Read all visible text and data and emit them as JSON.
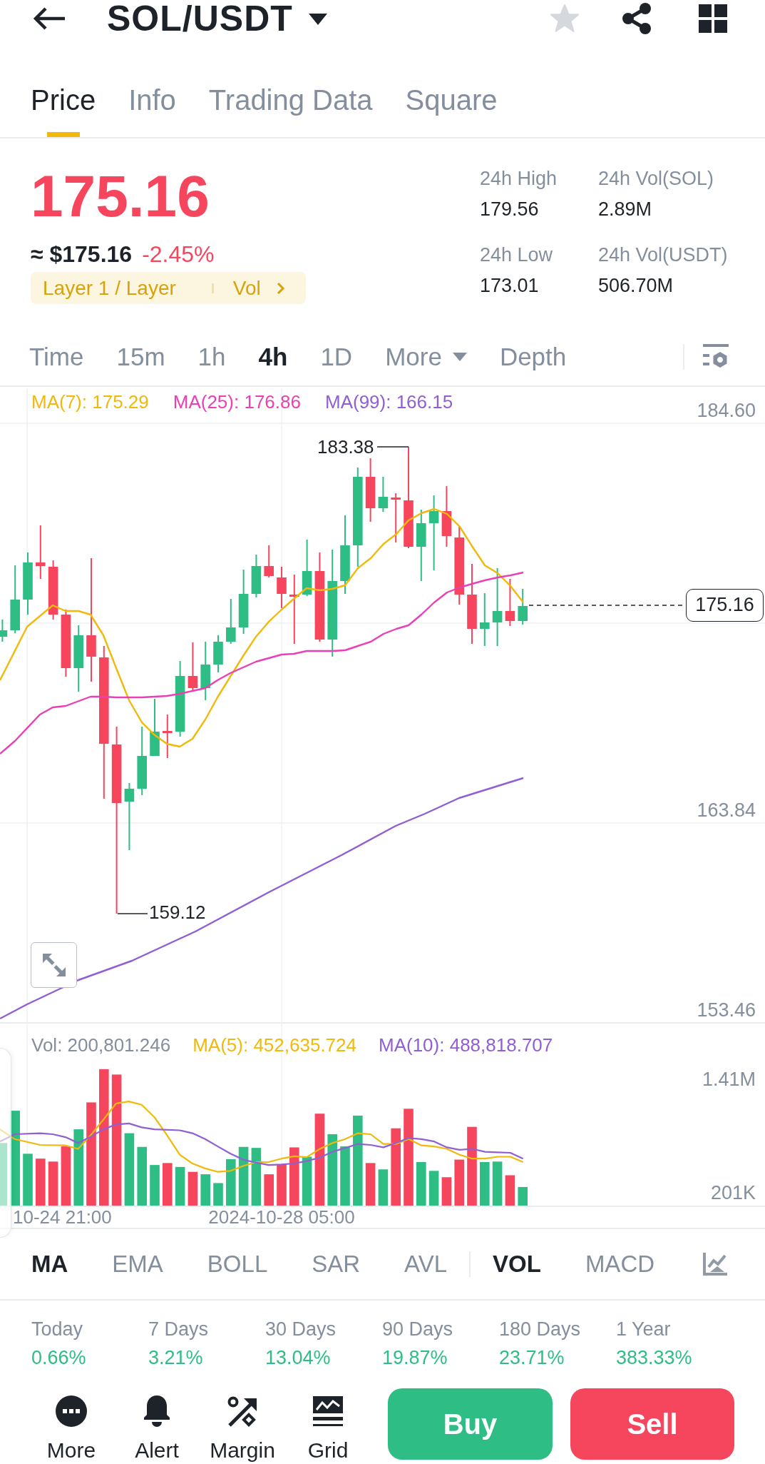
{
  "header": {
    "title": "SOL/USDT",
    "favorite": false
  },
  "tabs": [
    {
      "label": "Price",
      "selected": true
    },
    {
      "label": "Info",
      "selected": false
    },
    {
      "label": "Trading Data",
      "selected": false
    },
    {
      "label": "Square",
      "selected": false
    }
  ],
  "ticker": {
    "price": "175.16",
    "falling": true,
    "fiat_price": "≈ $175.16",
    "change": "-2.45%",
    "tags": [
      "Layer 1 / Layer",
      "Vol"
    ]
  },
  "stats": [
    {
      "label": "24h High",
      "value": "179.56"
    },
    {
      "label": "24h Vol(SOL)",
      "value": "2.89M"
    },
    {
      "label": "24h Low",
      "value": "173.01"
    },
    {
      "label": "24h Vol(USDT)",
      "value": "506.70M"
    }
  ],
  "intervals": [
    {
      "label": "Time",
      "kind": "option",
      "selected": false
    },
    {
      "label": "15m",
      "kind": "option",
      "selected": false
    },
    {
      "label": "1h",
      "kind": "option",
      "selected": false
    },
    {
      "label": "4h",
      "kind": "option",
      "selected": true
    },
    {
      "label": "1D",
      "kind": "option",
      "selected": false
    },
    {
      "label": "More",
      "kind": "dropdown",
      "selected": false
    },
    {
      "label": "Depth",
      "kind": "option",
      "selected": false
    }
  ],
  "price_chart": {
    "legend": [
      {
        "label": "MA(7): 175.29",
        "color": "#f0b90b"
      },
      {
        "label": "MA(25): 176.86",
        "color": "#eb40b5"
      },
      {
        "label": "MA(99): 166.15",
        "color": "#8f5fd3"
      }
    ],
    "axis_labels": [
      "184.60",
      "163.84",
      "153.46"
    ],
    "high_label": "183.38",
    "low_label": "159.12",
    "last_price": "175.16"
  },
  "volume_chart": {
    "legend": [
      {
        "label": "Vol: 200,801.246",
        "color": "#848e9c"
      },
      {
        "label": "MA(5): 452,635.724",
        "color": "#f0b90b"
      },
      {
        "label": "MA(10): 488,818.707",
        "color": "#8f5fd3"
      }
    ],
    "axis_labels": [
      "1.41M",
      "201K"
    ],
    "time_labels": [
      "10-24 21:00",
      "2024-10-28 05:00"
    ]
  },
  "main_indicators": [
    {
      "label": "MA",
      "selected": true
    },
    {
      "label": "EMA",
      "selected": false
    },
    {
      "label": "BOLL",
      "selected": false
    },
    {
      "label": "SAR",
      "selected": false
    },
    {
      "label": "AVL",
      "selected": false
    }
  ],
  "sub_indicators": [
    {
      "label": "VOL",
      "selected": true
    },
    {
      "label": "MACD",
      "selected": false
    }
  ],
  "performance": [
    {
      "label": "Today",
      "value": "0.66%"
    },
    {
      "label": "7 Days",
      "value": "3.21%"
    },
    {
      "label": "30 Days",
      "value": "13.04%"
    },
    {
      "label": "90 Days",
      "value": "19.87%"
    },
    {
      "label": "180 Days",
      "value": "23.71%"
    },
    {
      "label": "1 Year",
      "value": "383.33%"
    }
  ],
  "actions": [
    {
      "label": "More",
      "kind": "more"
    },
    {
      "label": "Alert",
      "kind": "alert"
    },
    {
      "label": "Margin",
      "kind": "margin"
    },
    {
      "label": "Grid",
      "kind": "grid"
    }
  ],
  "trade_buttons": [
    {
      "label": "Buy",
      "kind": "buy"
    },
    {
      "label": "Sell",
      "kind": "sell"
    }
  ]
}
